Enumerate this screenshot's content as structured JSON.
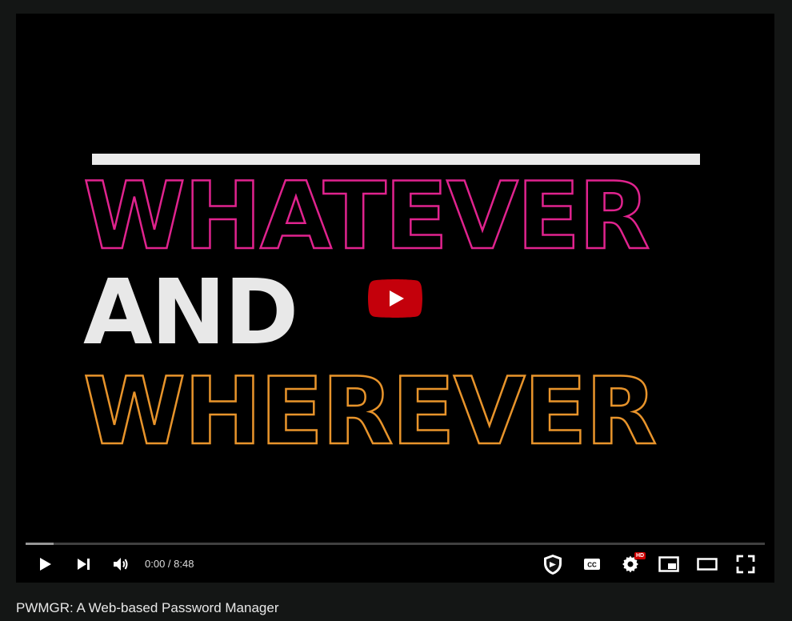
{
  "video": {
    "frame_words": {
      "line1": "WHATEVER",
      "line2": "AND",
      "line3": "WHEREVER"
    },
    "colors": {
      "line1_outline": "#e0238e",
      "line2_fill": "#e8e8e8",
      "line3_outline": "#e8942b",
      "play_button": "#c4000b"
    }
  },
  "controls": {
    "current_time": "0:00",
    "separator": " / ",
    "duration": "8:48",
    "progress_fraction": 0.0,
    "buffered_fraction": 0.038,
    "quality_badge": "HD",
    "icons": [
      "play-icon",
      "next-icon",
      "volume-icon",
      "shield-icon",
      "captions-icon",
      "settings-icon",
      "miniplayer-icon",
      "theater-mode-icon",
      "fullscreen-icon"
    ]
  },
  "caption": {
    "title": "PWMGR: A Web-based Password Manager"
  }
}
